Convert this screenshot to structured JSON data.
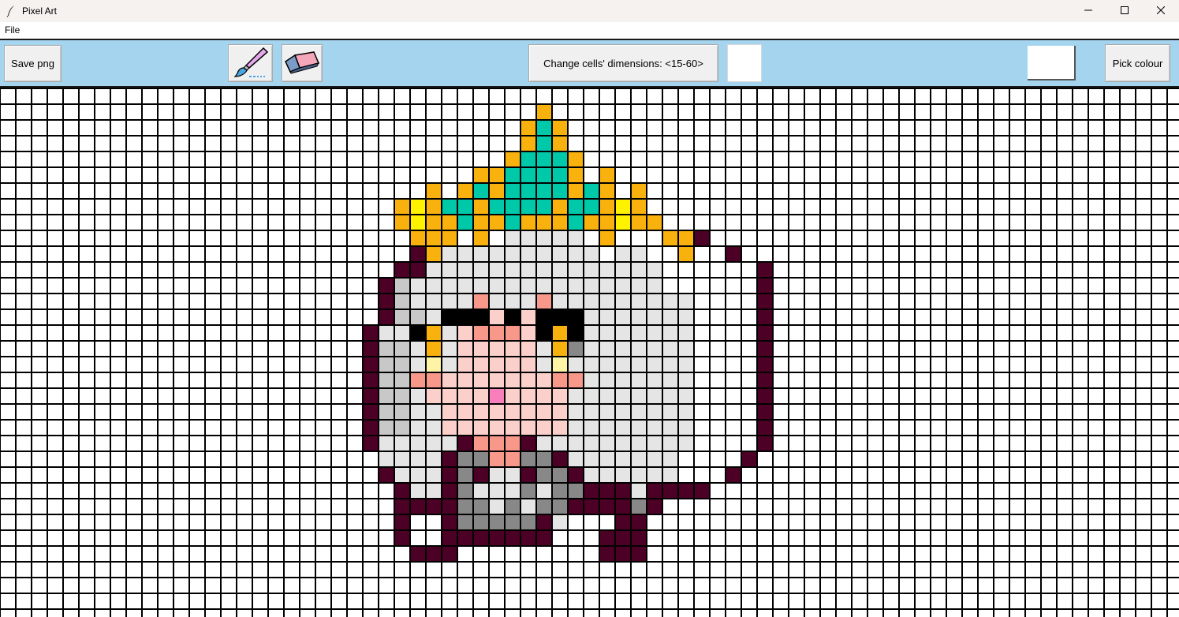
{
  "window": {
    "title": "Pixel Art",
    "controls": [
      "minimize-icon",
      "maximize-icon",
      "close-icon"
    ]
  },
  "menu": {
    "items": [
      "File"
    ]
  },
  "toolbar": {
    "save_label": "Save png",
    "brush_icon": "brush-icon",
    "eraser_icon": "eraser-icon",
    "dims_label": "Change cells' dimensions: <15-60>",
    "dims_value": "",
    "current_colour": "#ffffff",
    "pick_label": "Pick colour"
  },
  "colors": {
    "toolbar_bg": "#a4d4ee",
    "grid_line": "#000000"
  },
  "canvas": {
    "cols": 75,
    "rows": 34,
    "palette": {
      "O": "#f9b10e",
      "T": "#00c9aa",
      "Y": "#fff200",
      "D": "#4d0025",
      "L": "#e5e5e5",
      "G": "#c8c8c8",
      "M": "#888888",
      "S": "#f7988b",
      "P": "#fbd0ca",
      "K": "#000000",
      "C": "#fff3a6",
      "H": "#f97ebc",
      "R": "#666666"
    },
    "pixels": [
      ".........................................................................",
      "..................................O......................................",
      ".................................OTO.....................................",
      ".................................OTO.....................................",
      "................................OTTTO....................................",
      "..............................OOTTTTO.O..................................",
      "...........................O.OTOTTTTOTO.O................................",
      ".........................OYOTTOTTTTOTTOYO................................",
      ".........................OYOOTOOTOOOTOOYOO...............................",
      "..........................OOO.O.LLLLL.O...OOD............................",
      "..........................DOLLLLLLLLLL.LL..O..D...........................",
      ".........................DDLLLLLLLLLLLLLLL......D.........................",
      "........................DGLLLLLLLLLLLLLLLL......D.........................",
      "........................DGLLLLSLLLSLLLLLLLLL....D.........................",
      "........................DGGLKKKPKPKKKLLLLLLL....D.........................",
      ".......................DLLKOLPSSSPKOKLLLLLLL....D.........................",
      ".......................DGGLOLPPPPPLOMLLLLLLL....D.........................",
      ".......................DGGLCLPPPPPLCLLLLLLLL....D.........................",
      ".......................DGGSSPPPPPPPSSLLLLLLL....D.........................",
      ".......................DGGLPPPPHPPPPLLLLLLLL....D.........................",
      ".......................DGGLLPPPPPPPPLLLLLLLL....D.........................",
      ".......................DGGLLPPPPPPPPLLLLLLLL....D.........................",
      ".......................DLLLLLDSSSDLLLLLLLLLL....D.........................",
      "........................LLLLDMMSSMMDLLLLLLL....D..........................",
      "........................DLLLDMDLLDMMDLLLLLL...D...........................",
      ".........................DLLDMLLLMLMMDDDLDDDD.............................",
      ".........................DDDDMMLMLMMDDDDMD...............................",
      ".........................D..DMMMMMDL...DD................................",
      ".........................D..DDDDDDD...DDD................................",
      "..........................DDD.........DDD................................",
      ".........................................................................",
      ".........................................................................",
      ".........................................................................",
      "........................................................................."
    ]
  }
}
